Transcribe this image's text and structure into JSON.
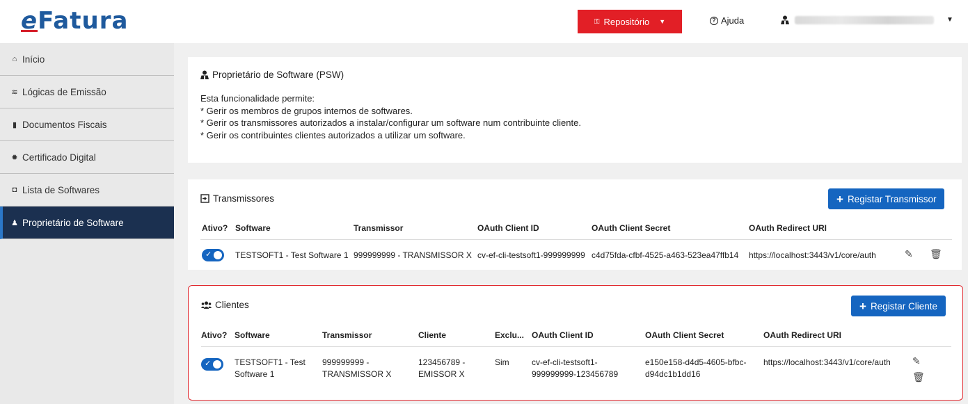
{
  "header": {
    "logo": "Fatura",
    "logo_e": "e",
    "repo_label": "Repositório",
    "help_label": "Ajuda"
  },
  "sidebar": {
    "items": [
      {
        "label": "Início",
        "icon": "home-icon"
      },
      {
        "label": "Lógicas de Emissão",
        "icon": "layers-icon"
      },
      {
        "label": "Documentos Fiscais",
        "icon": "file-icon"
      },
      {
        "label": "Certificado Digital",
        "icon": "certificate-icon"
      },
      {
        "label": "Lista de Softwares",
        "icon": "briefcase-icon"
      },
      {
        "label": "Proprietário de Software",
        "icon": "user-tie-icon",
        "active": true
      }
    ]
  },
  "psw": {
    "title": "Proprietário de Software (PSW)",
    "lines": [
      "Esta funcionalidade permite:",
      "* Gerir os membros de grupos internos de softwares.",
      "* Gerir os transmissores autorizados a instalar/configurar um software num contribuinte cliente.",
      "* Gerir os contribuintes clientes autorizados a utilizar um software."
    ]
  },
  "transmissores": {
    "title": "Transmissores",
    "button": "Registar Transmissor",
    "headers": [
      "Ativo?",
      "Software",
      "Transmissor",
      "OAuth Client ID",
      "OAuth Client Secret",
      "OAuth Redirect URI"
    ],
    "row": {
      "software": "TESTSOFT1 - Test Software 1",
      "transmissor": "999999999 - TRANSMISSOR X",
      "client_id": "cv-ef-cli-testsoft1-999999999",
      "client_secret": "c4d75fda-cfbf-4525-a463-523ea47ffb14",
      "redirect_uri": "https://localhost:3443/v1/core/auth"
    }
  },
  "clientes": {
    "title": "Clientes",
    "button": "Registar Cliente",
    "headers": [
      "Ativo?",
      "Software",
      "Transmissor",
      "Cliente",
      "Exclu...",
      "OAuth Client ID",
      "OAuth Client Secret",
      "OAuth Redirect URI"
    ],
    "row": {
      "software_1": "TESTSOFT1 - Test",
      "software_2": "Software 1",
      "transmissor_1": "999999999 -",
      "transmissor_2": "TRANSMISSOR X",
      "cliente_1": "123456789 -",
      "cliente_2": "EMISSOR X",
      "exclusivo": "Sim",
      "client_id_1": "cv-ef-cli-testsoft1-",
      "client_id_2": "999999999-123456789",
      "client_secret_1": "e150e158-d4d5-4605-bfbc-",
      "client_secret_2": "d94dc1b1dd16",
      "redirect_uri": "https://localhost:3443/v1/core/auth"
    }
  },
  "colors": {
    "primary": "#1565c0",
    "danger": "#e21f26",
    "sidebar_active": "#1b3050",
    "brand": "#1f5a9d"
  }
}
